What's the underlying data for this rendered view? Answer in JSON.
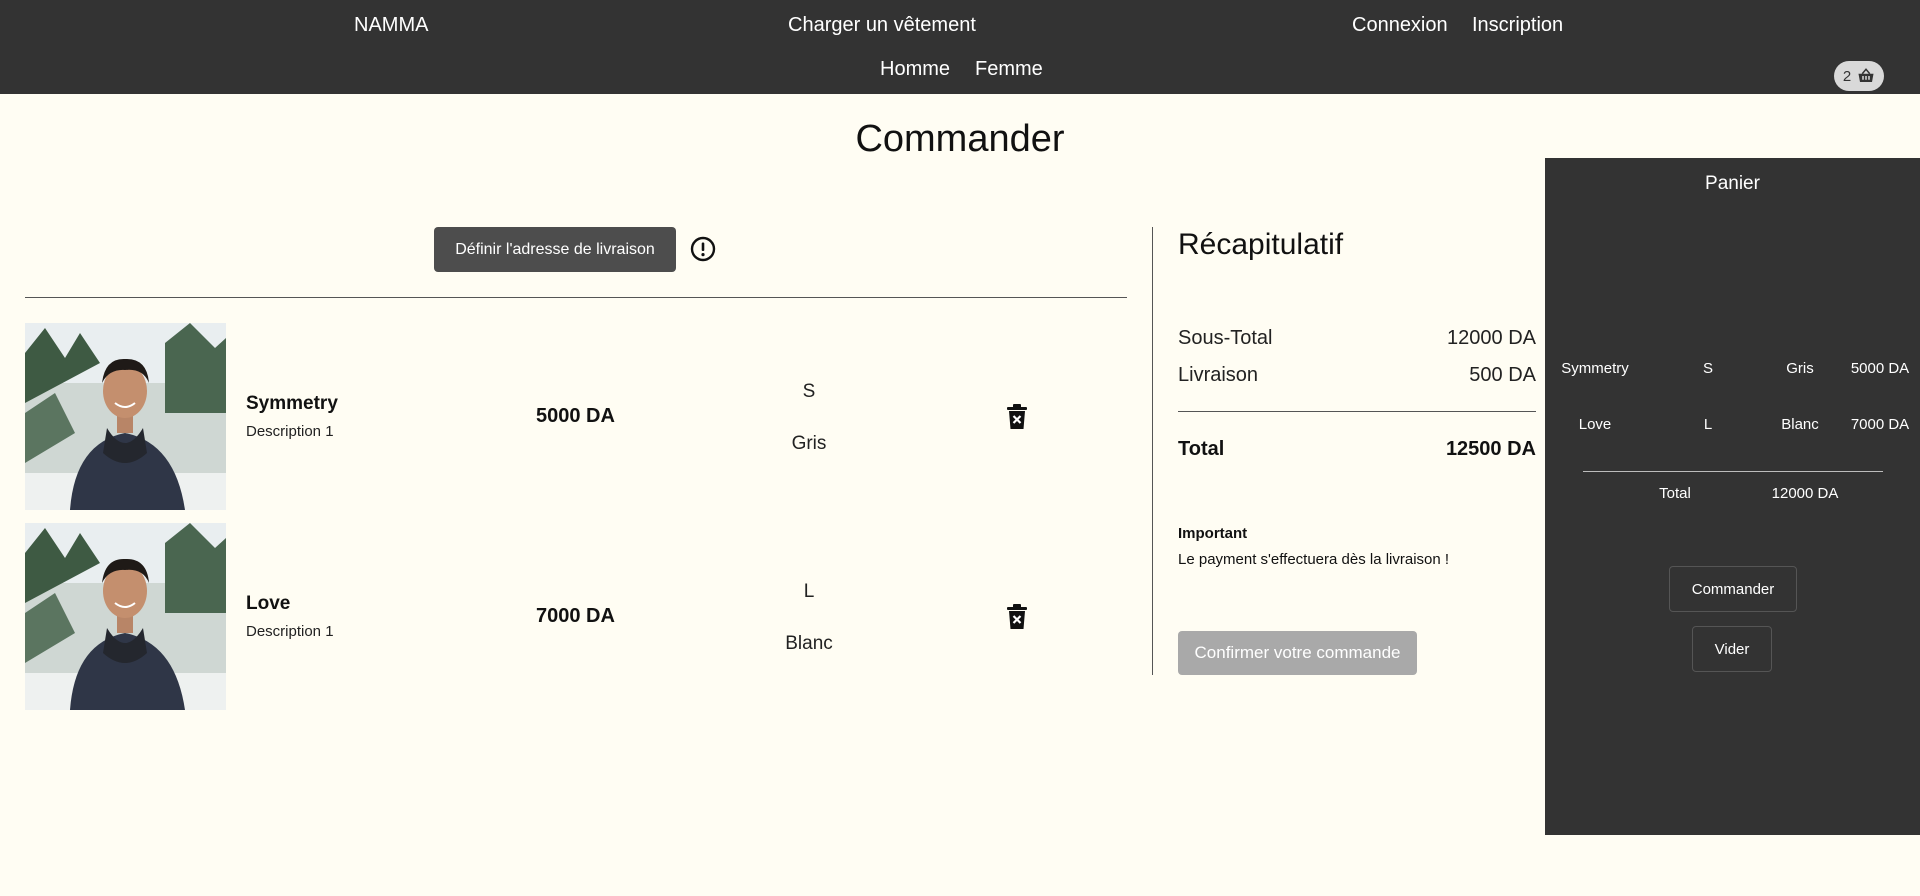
{
  "header": {
    "brand": "NAMMA",
    "upload": "Charger un vêtement",
    "login": "Connexion",
    "signup": "Inscription",
    "nav": [
      "Homme",
      "Femme"
    ],
    "cart_count": "2"
  },
  "page": {
    "title": "Commander",
    "address_button": "Définir l'adresse de livraison"
  },
  "items": [
    {
      "name": "Symmetry",
      "description": "Description 1",
      "price": "5000 DA",
      "size": "S",
      "color": "Gris"
    },
    {
      "name": "Love",
      "description": "Description 1",
      "price": "7000 DA",
      "size": "L",
      "color": "Blanc"
    }
  ],
  "summary": {
    "title": "Récapitulatif",
    "subtotal_label": "Sous-Total",
    "subtotal_value": "12000 DA",
    "shipping_label": "Livraison",
    "shipping_value": "500 DA",
    "total_label": "Total",
    "total_value": "12500 DA",
    "important_label": "Important",
    "important_text": "Le payment s'effectuera dès la livraison !",
    "confirm_button": "Confirmer votre commande"
  },
  "cart_panel": {
    "title": "Panier",
    "rows": [
      {
        "name": "Symmetry",
        "size": "S",
        "color": "Gris",
        "price": "5000 DA"
      },
      {
        "name": "Love",
        "size": "L",
        "color": "Blanc",
        "price": "7000 DA"
      }
    ],
    "total_label": "Total",
    "total_value": "12000 DA",
    "order_button": "Commander",
    "empty_button": "Vider"
  },
  "colors": {
    "header_bg": "#333333",
    "page_bg": "#fffdf3",
    "address_button_bg": "#4d4d4d",
    "confirm_button_bg": "#a9a9a9"
  },
  "icons": {
    "cart": "basket-icon",
    "alert": "alert-circle-icon",
    "delete": "trash-x-icon"
  }
}
